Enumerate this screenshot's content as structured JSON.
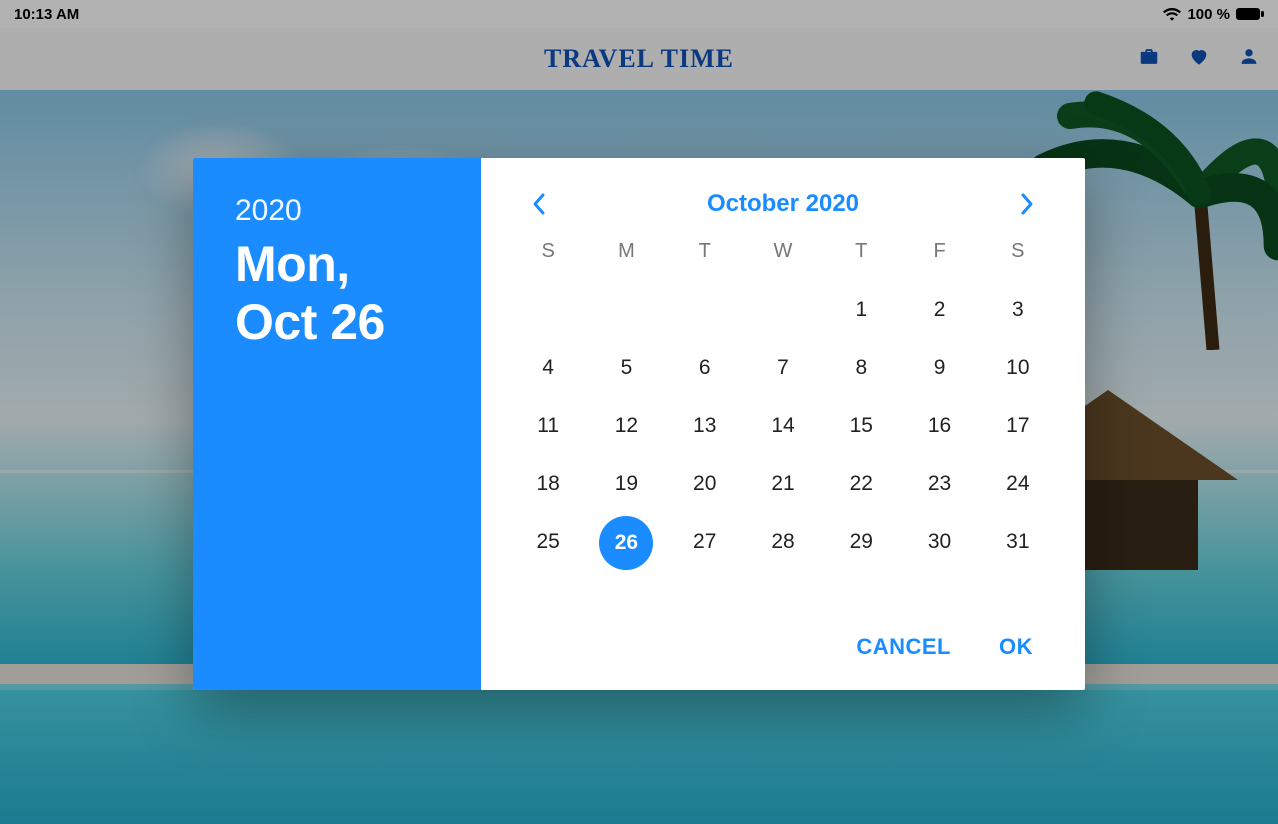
{
  "status": {
    "time": "10:13 AM",
    "battery_text": "100 %"
  },
  "app": {
    "title": "TRAVEL TIME"
  },
  "datepicker": {
    "year": "2020",
    "selected_display": "Mon,\nOct 26",
    "month_label": "October 2020",
    "weekdays": [
      "S",
      "M",
      "T",
      "W",
      "T",
      "F",
      "S"
    ],
    "lead_blanks": 4,
    "days_in_month": 31,
    "selected_day": 26,
    "actions": {
      "cancel": "CANCEL",
      "ok": "OK"
    }
  },
  "colors": {
    "accent": "#1a8cff"
  }
}
